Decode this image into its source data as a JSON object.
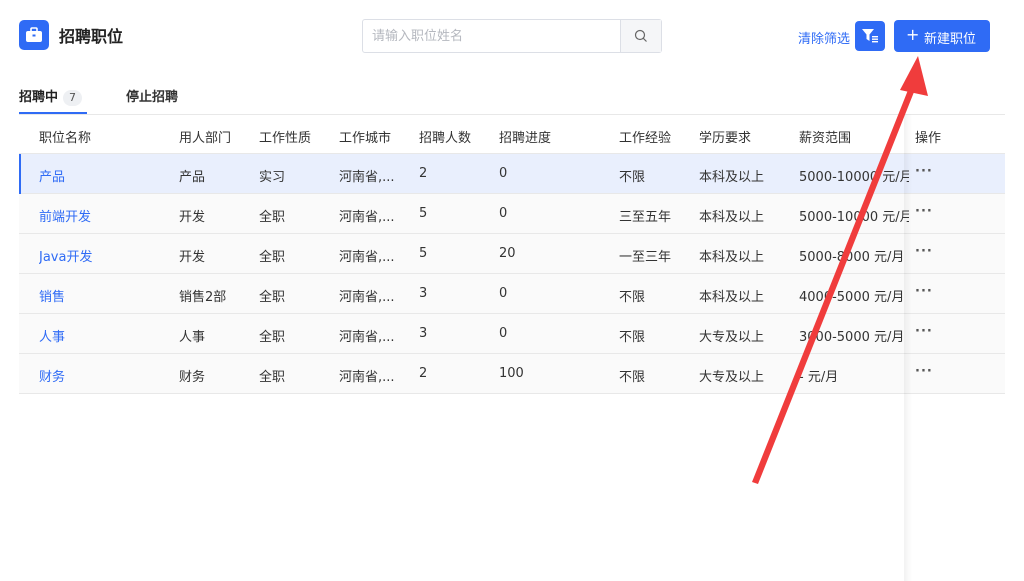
{
  "header": {
    "title": "招聘职位",
    "search_placeholder": "请输入职位姓名",
    "clear_filter": "清除筛选",
    "new_position": "新建职位"
  },
  "tabs": [
    {
      "label": "招聘中",
      "count": "7"
    },
    {
      "label": "停止招聘"
    }
  ],
  "table": {
    "columns": [
      "职位名称",
      "用人部门",
      "工作性质",
      "工作城市",
      "招聘人数",
      "招聘进度",
      "工作经验",
      "学历要求",
      "薪资范围",
      "操作"
    ],
    "rows": [
      {
        "name": "产品",
        "dept": "产品",
        "type": "实习",
        "city": "河南省,...",
        "count": "2",
        "progress": "0",
        "experience": "不限",
        "education": "本科及以上",
        "salary": "5000-10000 元/月",
        "op": "···"
      },
      {
        "name": "前端开发",
        "dept": "开发",
        "type": "全职",
        "city": "河南省,...",
        "count": "5",
        "progress": "0",
        "experience": "三至五年",
        "education": "本科及以上",
        "salary": "5000-10000 元/月",
        "op": "···"
      },
      {
        "name": "Java开发",
        "dept": "开发",
        "type": "全职",
        "city": "河南省,...",
        "count": "5",
        "progress": "20",
        "experience": "一至三年",
        "education": "本科及以上",
        "salary": "5000-8000 元/月",
        "op": "···"
      },
      {
        "name": "销售",
        "dept": "销售2部",
        "type": "全职",
        "city": "河南省,...",
        "count": "3",
        "progress": "0",
        "experience": "不限",
        "education": "本科及以上",
        "salary": "4000-5000 元/月",
        "op": "···"
      },
      {
        "name": "人事",
        "dept": "人事",
        "type": "全职",
        "city": "河南省,...",
        "count": "3",
        "progress": "0",
        "experience": "不限",
        "education": "大专及以上",
        "salary": "3000-5000 元/月",
        "op": "···"
      },
      {
        "name": "财务",
        "dept": "财务",
        "type": "全职",
        "city": "河南省,...",
        "count": "2",
        "progress": "100",
        "experience": "不限",
        "education": "大专及以上",
        "salary": "- 元/月",
        "op": "···"
      }
    ]
  },
  "colors": {
    "primary": "#2f6bf5",
    "annotation_arrow": "#f03c3c",
    "selected_row": "#e9effd"
  },
  "icons": [
    "briefcase-icon",
    "search-icon",
    "filter-icon",
    "plus-icon",
    "more-icon"
  ]
}
